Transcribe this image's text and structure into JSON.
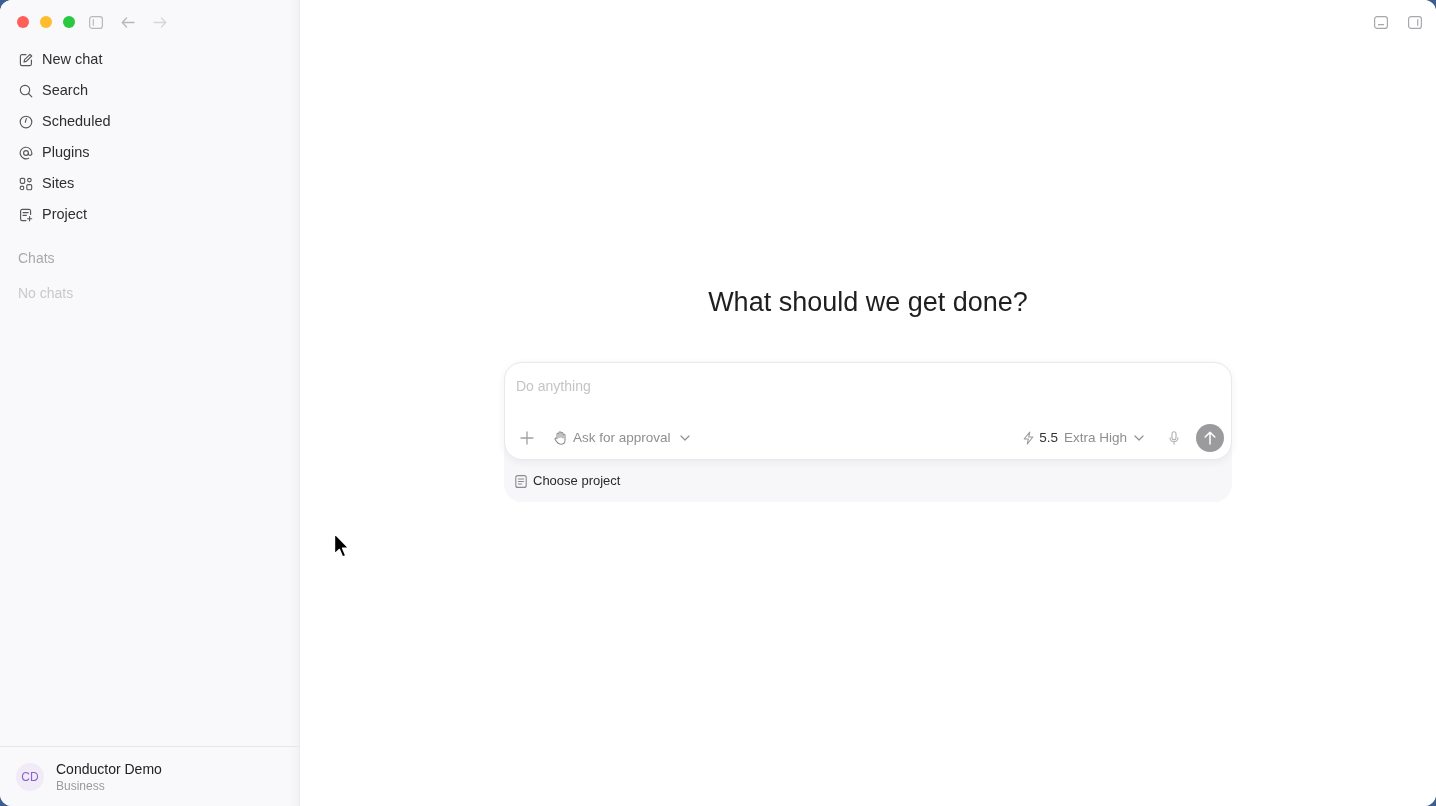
{
  "sidebar": {
    "nav_items": [
      {
        "label": "New chat"
      },
      {
        "label": "Search"
      },
      {
        "label": "Scheduled"
      },
      {
        "label": "Plugins"
      },
      {
        "label": "Sites"
      },
      {
        "label": "Project"
      }
    ],
    "chats_section": {
      "title": "Chats",
      "empty_text": "No chats"
    },
    "account": {
      "initials": "CD",
      "name": "Conductor Demo",
      "plan": "Business"
    }
  },
  "main": {
    "heading": "What should we get done?",
    "composer": {
      "placeholder": "Do anything",
      "approval_mode": "Ask for approval",
      "model_version": "5.5",
      "reasoning_effort": "Extra High"
    },
    "project_picker": "Choose project"
  }
}
